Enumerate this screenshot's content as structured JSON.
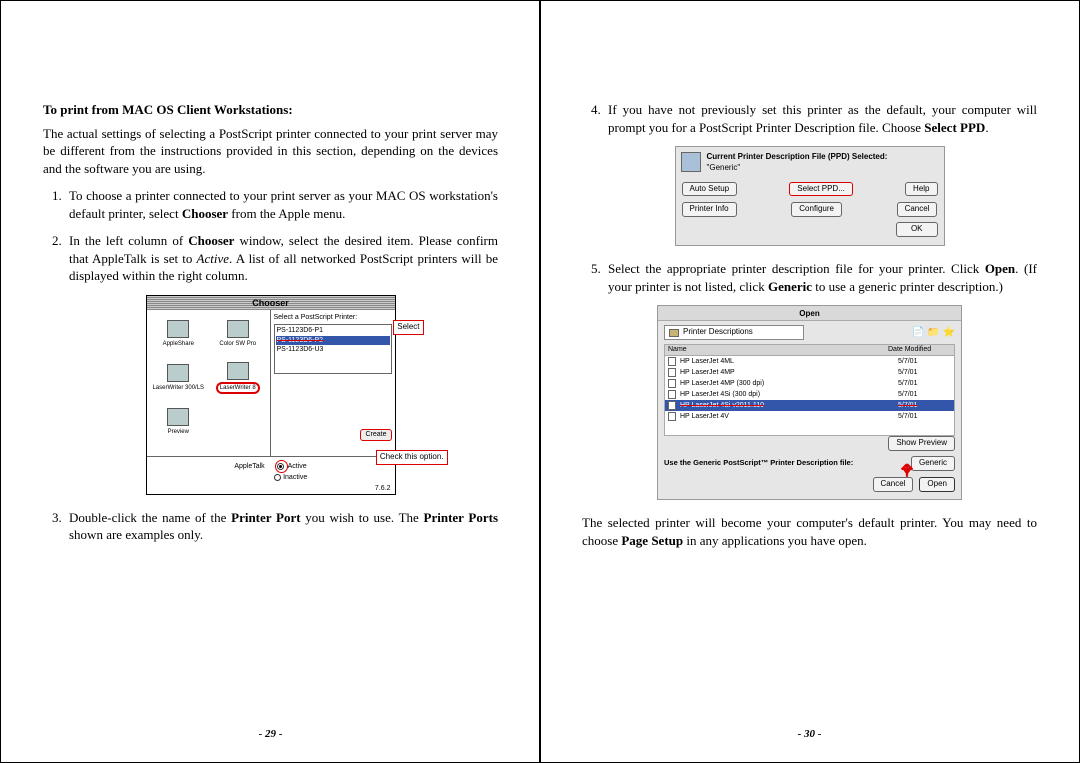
{
  "left": {
    "heading": "To print from MAC OS Client Workstations:",
    "intro": "The actual settings of selecting a PostScript printer connected to your print server may be different from the instructions provided in this section, depending on the devices and the software you are using.",
    "step1_a": "To choose a printer connected to your print server as your MAC OS workstation's default printer, select ",
    "step1_b": "Chooser",
    "step1_c": " from the Apple menu.",
    "step2_a": "In the left column of ",
    "step2_b": "Chooser",
    "step2_c": " window, select the desired item. Please confirm that AppleTalk is set to ",
    "step2_d": "Active",
    "step2_e": ".  A list of all networked PostScript printers will be displayed within the right column.",
    "step3_a": "Double-click the name of the ",
    "step3_b": "Printer Port",
    "step3_c": " you wish to use.   The ",
    "step3_d": "Printer Ports",
    "step3_e": " shown are examples only.",
    "pagenum": "- 29 -"
  },
  "chooser": {
    "title": "Chooser",
    "icons": {
      "appleshare": "AppleShare",
      "colorsw": "Color SW Pro",
      "laserwriter300": "LaserWriter 300/LS",
      "laserwriter8": "LaserWriter 8",
      "preview": "Preview"
    },
    "right_title": "Select a PostScript Printer:",
    "ps1": "PS-1123D6-P1",
    "ps2": "PS-1123D6-P2",
    "ps3": "PS-1123D6-U3",
    "create_btn": "Create",
    "appletalk": "AppleTalk",
    "active": "Active",
    "inactive": "Inactive",
    "version": "7.6.2",
    "label_select": "Select",
    "label_check": "Check this option."
  },
  "right": {
    "step4_a": "If you have not previously set this printer as the default, your computer will prompt you for a PostScript Printer Description file. Choose ",
    "step4_b": "Select PPD",
    "step4_c": ".",
    "step5_a": "Select the appropriate printer description file for your printer. Click ",
    "step5_b": "Open",
    "step5_c": ".   (If your printer is not listed, click ",
    "step5_d": "Generic",
    "step5_e": " to use a generic printer description.)",
    "closing_a": "The selected printer will become your computer's default printer. You may need to choose ",
    "closing_b": "Page Setup",
    "closing_c": " in any applications you have open.",
    "pagenum": "- 30 -"
  },
  "ppd": {
    "hdr": "Current Printer Description File (PPD) Selected:",
    "sub": "\"Generic\"",
    "auto": "Auto Setup",
    "selectppd": "Select PPD...",
    "help": "Help",
    "printerinfo": "Printer Info",
    "configure": "Configure",
    "cancel": "Cancel",
    "ok": "OK"
  },
  "open": {
    "title": "Open",
    "combo": "Printer Descriptions",
    "col_name": "Name",
    "col_date": "Date Modified",
    "rows": [
      {
        "name": "HP LaserJet 4ML",
        "date": "5/7/01"
      },
      {
        "name": "HP LaserJet 4MP",
        "date": "5/7/01"
      },
      {
        "name": "HP LaserJet 4MP (300 dpi)",
        "date": "5/7/01"
      },
      {
        "name": "HP LaserJet 4Si (300 dpi)",
        "date": "5/7/01"
      },
      {
        "name": "HP LaserJet 4Si v2011.110",
        "date": "5/7/01"
      },
      {
        "name": "HP LaserJet 4V",
        "date": "5/7/01"
      }
    ],
    "showpreview": "Show Preview",
    "footertxt": "Use the Generic PostScript™ Printer Description file:",
    "generic": "Generic",
    "cancel": "Cancel",
    "openbtn": "Open"
  }
}
